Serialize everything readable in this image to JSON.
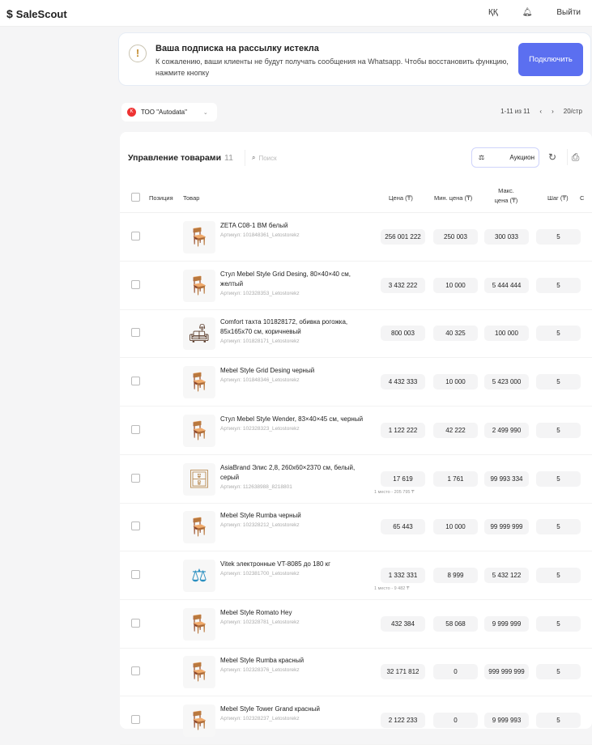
{
  "header": {
    "logo": "SaleScout",
    "lang": "ҚҚ",
    "bell_icon": "bell-icon",
    "logout": "Выйти"
  },
  "banner": {
    "title": "Ваша подписка на рассылку истекла",
    "text": "К сожалению, ваши клиенты не будут получать сообщения на Whatsapp. Чтобы восстановить функцию, нажмите кнопку",
    "button": "Подключить"
  },
  "company": {
    "name": "ТОО \"Autodata\""
  },
  "pagination": {
    "range": "1-11 из 11",
    "prev": "‹",
    "next": "›",
    "per_page": "20/стр"
  },
  "card": {
    "title": "Управление товарами",
    "count": "11",
    "search_placeholder": "Поиск",
    "auction": "Аукцион"
  },
  "columns": {
    "position": "Позиция",
    "product": "Товар",
    "price": "Цена (₸)",
    "min": "Мин. цена (₸)",
    "max": "Макс. цена (₸)",
    "step": "Шаг (₸)",
    "more": "С"
  },
  "rows": [
    {
      "name": "ZETA C08-1 BM белый",
      "sku": "Артикул: 101848361_Letostorekz",
      "price": "256 001 222",
      "min": "250 003",
      "max": "300 033",
      "step": "5",
      "emoji": "🪑"
    },
    {
      "name": "Стул Mebel Style Grid Desing, 80×40×40 см, желтый",
      "sku": "Артикул: 102328353_Letostorekz",
      "price": "3 432 222",
      "min": "10 000",
      "max": "5 444 444",
      "step": "5",
      "emoji": "🪑"
    },
    {
      "name": "Comfort тахта 101828172, обивка рогожка, 85x165x70 см, коричневый",
      "sku": "Артикул: 101828171_Letostorekz",
      "price": "800 003",
      "min": "40 325",
      "max": "100 000",
      "step": "5",
      "emoji": "🛋"
    },
    {
      "name": "Mebel Style Grid Desing черный",
      "sku": "Артикул: 101848346_Letostorekz",
      "price": "4 432 333",
      "min": "10 000",
      "max": "5 423 000",
      "step": "5",
      "emoji": "🪑"
    },
    {
      "name": "Стул Mebel Style Wender, 83×40×45 см, черный",
      "sku": "Артикул: 102328323_Letostorekz",
      "price": "1 122 222",
      "min": "42 222",
      "max": "2 499 990",
      "step": "5",
      "emoji": "🪑"
    },
    {
      "name": "AsiaBrand Элис 2,8, 260х60×2370 см, белый, серый",
      "sku": "Артикул: 112638988_8218801",
      "price": "17 619",
      "min": "1 761",
      "max": "99 993 334",
      "step": "5",
      "emoji": "🗄",
      "note": "1 место - 205 795 ₸"
    },
    {
      "name": "Mebel Style Rumba черный",
      "sku": "Артикул: 102328212_Letostorekz",
      "price": "65 443",
      "min": "10 000",
      "max": "99 999 999",
      "step": "5",
      "emoji": "🪑"
    },
    {
      "name": "Vitek электронные VT-8085 до 180 кг",
      "sku": "Артикул: 102381700_Letostorekz",
      "price": "1 332 331",
      "min": "8 999",
      "max": "5 432 122",
      "step": "5",
      "emoji": "⚖",
      "note": "1 место - 9 482 ₸"
    },
    {
      "name": "Mebel Style Romato Hey",
      "sku": "Артикул: 102328781_Letostorekz",
      "price": "432 384",
      "min": "58 068",
      "max": "9 999 999",
      "step": "5",
      "emoji": "🪑"
    },
    {
      "name": "Mebel Style Rumba красный",
      "sku": "Артикул: 102328376_Letostorekz",
      "price": "32 171 812",
      "min": "0",
      "max": "999 999 999",
      "step": "5",
      "emoji": "🪑"
    },
    {
      "name": "Mebel Style Tower Grand красный",
      "sku": "Артикул: 102328237_Letostorekz",
      "price": "2 122 233",
      "min": "0",
      "max": "9 999 993",
      "step": "5",
      "emoji": "🪑"
    }
  ]
}
